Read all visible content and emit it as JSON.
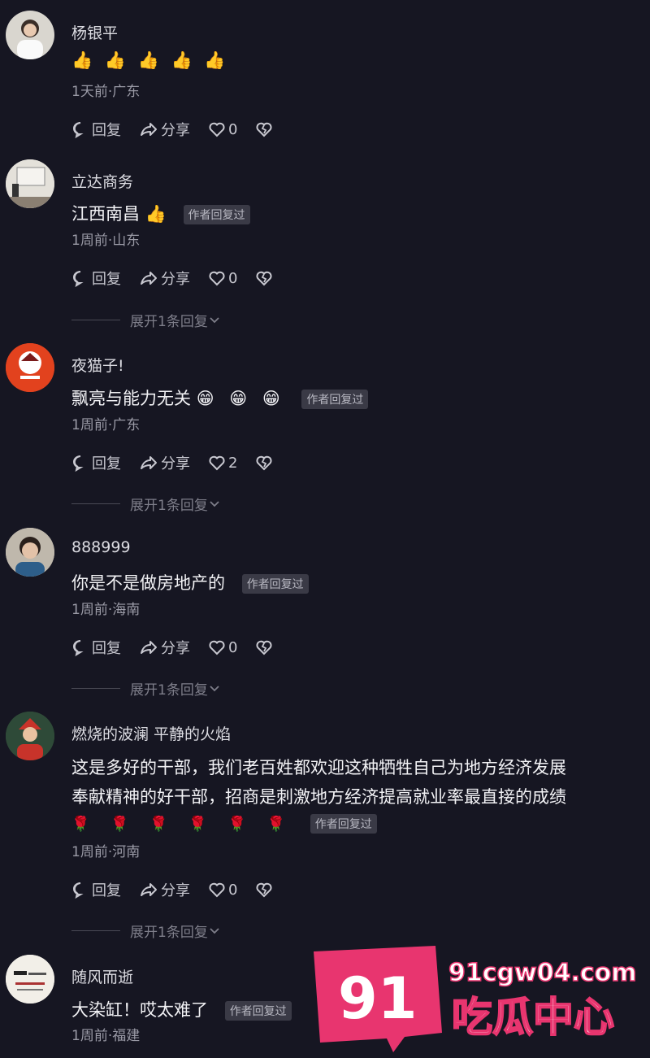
{
  "comments": [
    {
      "username": "杨银平",
      "text": "",
      "emojis": "👍 👍 👍 👍 👍",
      "meta": "1天前·广东",
      "likes": "0",
      "has_badge": false,
      "expand": ""
    },
    {
      "username": "立达商务",
      "text": "江西南昌",
      "emojis": "👍",
      "meta": "1周前·山东",
      "likes": "0",
      "badge": "作者回复过",
      "expand": "展开1条回复"
    },
    {
      "username": "夜猫子!",
      "text": "飘亮与能力无关",
      "emojis": "😁 😁 😁",
      "meta": "1周前·广东",
      "likes": "2",
      "badge": "作者回复过",
      "expand": "展开1条回复"
    },
    {
      "username": "888999",
      "text": "你是不是做房地产的",
      "meta": "1周前·海南",
      "likes": "0",
      "badge": "作者回复过",
      "expand": "展开1条回复"
    },
    {
      "username": "燃烧的波澜 平静的火焰",
      "text_line1": "这是多好的干部，我们老百姓都欢迎这种牺牲自己为地方经济发展",
      "text_line2": "奉献精神的好干部，招商是刺激地方经济提高就业率最直接的成绩",
      "emojis": "🌹 🌹 🌹 🌹 🌹 🌹",
      "meta": "1周前·河南",
      "likes": "0",
      "badge": "作者回复过",
      "expand": "展开1条回复"
    },
    {
      "username": "随风而逝",
      "text": "大染缸！哎太难了",
      "meta": "1周前·福建",
      "badge": "作者回复过"
    }
  ],
  "actions": {
    "reply": "回复",
    "share": "分享"
  },
  "watermark": {
    "number": "91",
    "domain": "91cgw04.com",
    "name": "吃瓜中心"
  },
  "colors": {
    "background": "#161622",
    "watermark_pink": "#e8356f"
  }
}
